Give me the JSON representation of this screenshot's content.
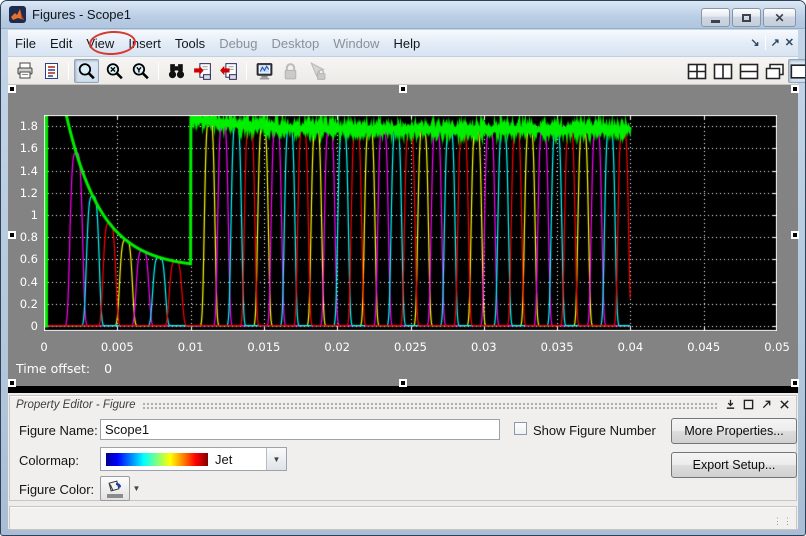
{
  "window": {
    "title": "Figures - Scope1",
    "controls": {
      "minimize": "minimize",
      "maximize": "maximize",
      "close": "close"
    }
  },
  "menu": {
    "items": [
      {
        "label": "File",
        "enabled": true
      },
      {
        "label": "Edit",
        "enabled": true
      },
      {
        "label": "View",
        "enabled": true,
        "annotated": true
      },
      {
        "label": "Insert",
        "enabled": true
      },
      {
        "label": "Tools",
        "enabled": true
      },
      {
        "label": "Debug",
        "enabled": false
      },
      {
        "label": "Desktop",
        "enabled": false
      },
      {
        "label": "Window",
        "enabled": false
      },
      {
        "label": "Help",
        "enabled": true
      }
    ],
    "right_icons": [
      "dock-figure-icon",
      "undock-icon",
      "close-icon"
    ]
  },
  "annotation": {
    "shape": "ellipse",
    "color": "#d8392f",
    "around": "View"
  },
  "toolbar": {
    "left_icons": [
      "print-icon",
      "parameters-icon",
      "zoom-icon",
      "zoom-x-axis-icon",
      "zoom-y-axis-icon",
      "autoscale-binoculars-icon",
      "save-axes-settings-icon",
      "restore-axes-settings-icon",
      "floating-scope-icon",
      "lock-axes-icon",
      "signal-selection-icon"
    ],
    "pressed": [
      "zoom-icon",
      "single-window-icon"
    ],
    "disabled": [
      "lock-axes-icon",
      "signal-selection-icon"
    ],
    "right_icons": [
      "tile-windows-icon",
      "split-vertical-icon",
      "split-horizontal-icon",
      "cascade-windows-icon",
      "single-window-icon"
    ]
  },
  "scope": {
    "time_offset_label": "Time offset:",
    "time_offset_value": "0"
  },
  "chart_data": {
    "type": "line",
    "title": "",
    "xlabel": "",
    "ylabel": "",
    "xlim": [
      0,
      0.05
    ],
    "ylim": [
      -0.045,
      1.9
    ],
    "x_ticks": [
      0,
      0.005,
      0.01,
      0.015,
      0.02,
      0.025,
      0.03,
      0.035,
      0.04,
      0.045,
      0.05
    ],
    "x_tick_labels": [
      "0",
      "0.005",
      "0.01",
      "0.015",
      "0.02",
      "0.025",
      "0.03",
      "0.035",
      "0.04",
      "0.045",
      "0.05"
    ],
    "y_ticks": [
      0,
      0.2,
      0.4,
      0.6,
      0.8,
      1.0,
      1.2,
      1.4,
      1.6,
      1.8
    ],
    "y_tick_labels": [
      "0",
      "0.2",
      "0.4",
      "0.6",
      "0.8",
      "1",
      "1.2",
      "1.4",
      "1.6",
      "1.8"
    ],
    "grid": "dotted-white",
    "plot_bg": "#000000",
    "figure_bg": "#838383",
    "signals": {
      "description": "Green exponential envelope decaying 1.9->0.52 until t=0.01, jumping to ~1.88 and settling as noisy band ~1.78 until t=0.04; bell pulse trains (yellow/magenta/cyan/red) whose peaks follow the envelope; all traces end at t=0.04; baseline at 0.",
      "envelope": {
        "color": "#00ee00",
        "rise_time": 0.00018,
        "phase1": {
          "base": 0.52,
          "amp": 2.6,
          "tau": 0.0024,
          "t_end": 0.01
        },
        "phase2": {
          "base": 1.77,
          "amp": 0.11,
          "tau": 0.0035,
          "noise": 0.022,
          "t_start": 0.01
        }
      },
      "pulses": {
        "colors": [
          "#ffff00",
          "#ff00ff",
          "#00ffff",
          "#ff0000"
        ],
        "power": 4,
        "slow": {
          "start": 0.0022,
          "period": 0.00113,
          "count": 7,
          "sigma": 0.00048,
          "first_color": 1
        },
        "fast": {
          "start": 0.0113,
          "period": 0.00091,
          "count": 32,
          "sigma": 0.0004,
          "first_color": 0
        }
      },
      "draw_end": 0.04
    }
  },
  "property_editor": {
    "title": "Property Editor - Figure",
    "header_icons": [
      "dock-panel-icon",
      "maximize-panel-icon",
      "undock-panel-icon",
      "close-panel-icon"
    ],
    "figure_name_label": "Figure Name:",
    "figure_name_value": "Scope1",
    "show_figure_number_label": "Show Figure Number",
    "show_figure_number_checked": false,
    "more_properties_label": "More Properties...",
    "colormap_label": "Colormap:",
    "colormap_value": "Jet",
    "export_setup_label": "Export Setup...",
    "figure_color_label": "Figure Color:"
  }
}
